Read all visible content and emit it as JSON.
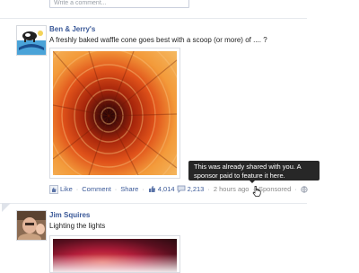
{
  "feed": {
    "comment_box": {
      "placeholder": "Write a comment..."
    },
    "posts": [
      {
        "author": "Ben & Jerry's",
        "message": "A freshly baked waffle cone goes best with a scoop (or more) of .... ?",
        "actions": {
          "like": "Like",
          "comment": "Comment",
          "share": "Share",
          "likes_count": "4,014",
          "comments_count": "2,213",
          "timestamp": "2 hours ago",
          "sponsored": "Sponsored"
        }
      },
      {
        "author": "Jim Squires",
        "message": "Lighting the lights"
      }
    ],
    "tooltip": "This was already shared with you. A sponsor paid to feature it here."
  },
  "colors": {
    "link": "#3b5998",
    "tooltip_bg": "#272727",
    "meta_text": "#888888"
  },
  "icons": {
    "like": "thumbs-up-icon",
    "comment": "speech-bubble-icon",
    "privacy": "globe-icon",
    "cursor": "hand-pointer-icon"
  }
}
